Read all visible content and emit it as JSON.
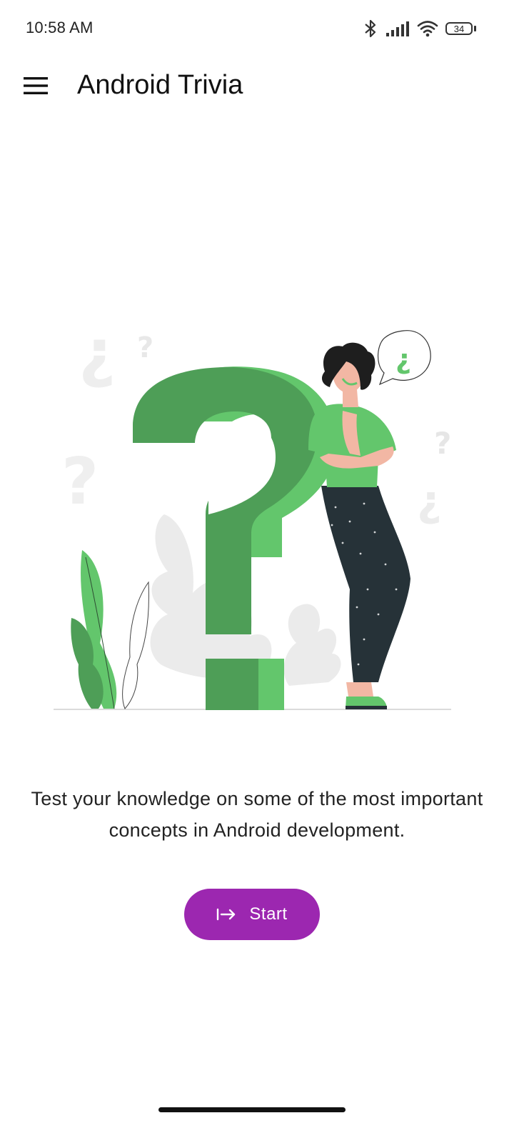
{
  "status_bar": {
    "time": "10:58 AM",
    "battery_level": "34",
    "icons": [
      "bluetooth-icon",
      "signal-icon",
      "wifi-icon",
      "battery-icon"
    ]
  },
  "app_bar": {
    "title": "Android Trivia",
    "menu_icon": "hamburger-menu-icon"
  },
  "illustration": {
    "speech_bubble_text": "¿",
    "colors": {
      "green_dark": "#4e9e57",
      "green_light": "#63c66c",
      "skin": "#f2b7a4",
      "pants": "#263238",
      "hair": "#1e1e1e",
      "bg_gray": "#ebebeb"
    }
  },
  "main": {
    "description": "Test your knowledge on some of the most important concepts in Android development.",
    "start_button": {
      "label": "Start",
      "icon": "arrow-right-to-line-icon",
      "color": "#9c27b0"
    }
  }
}
